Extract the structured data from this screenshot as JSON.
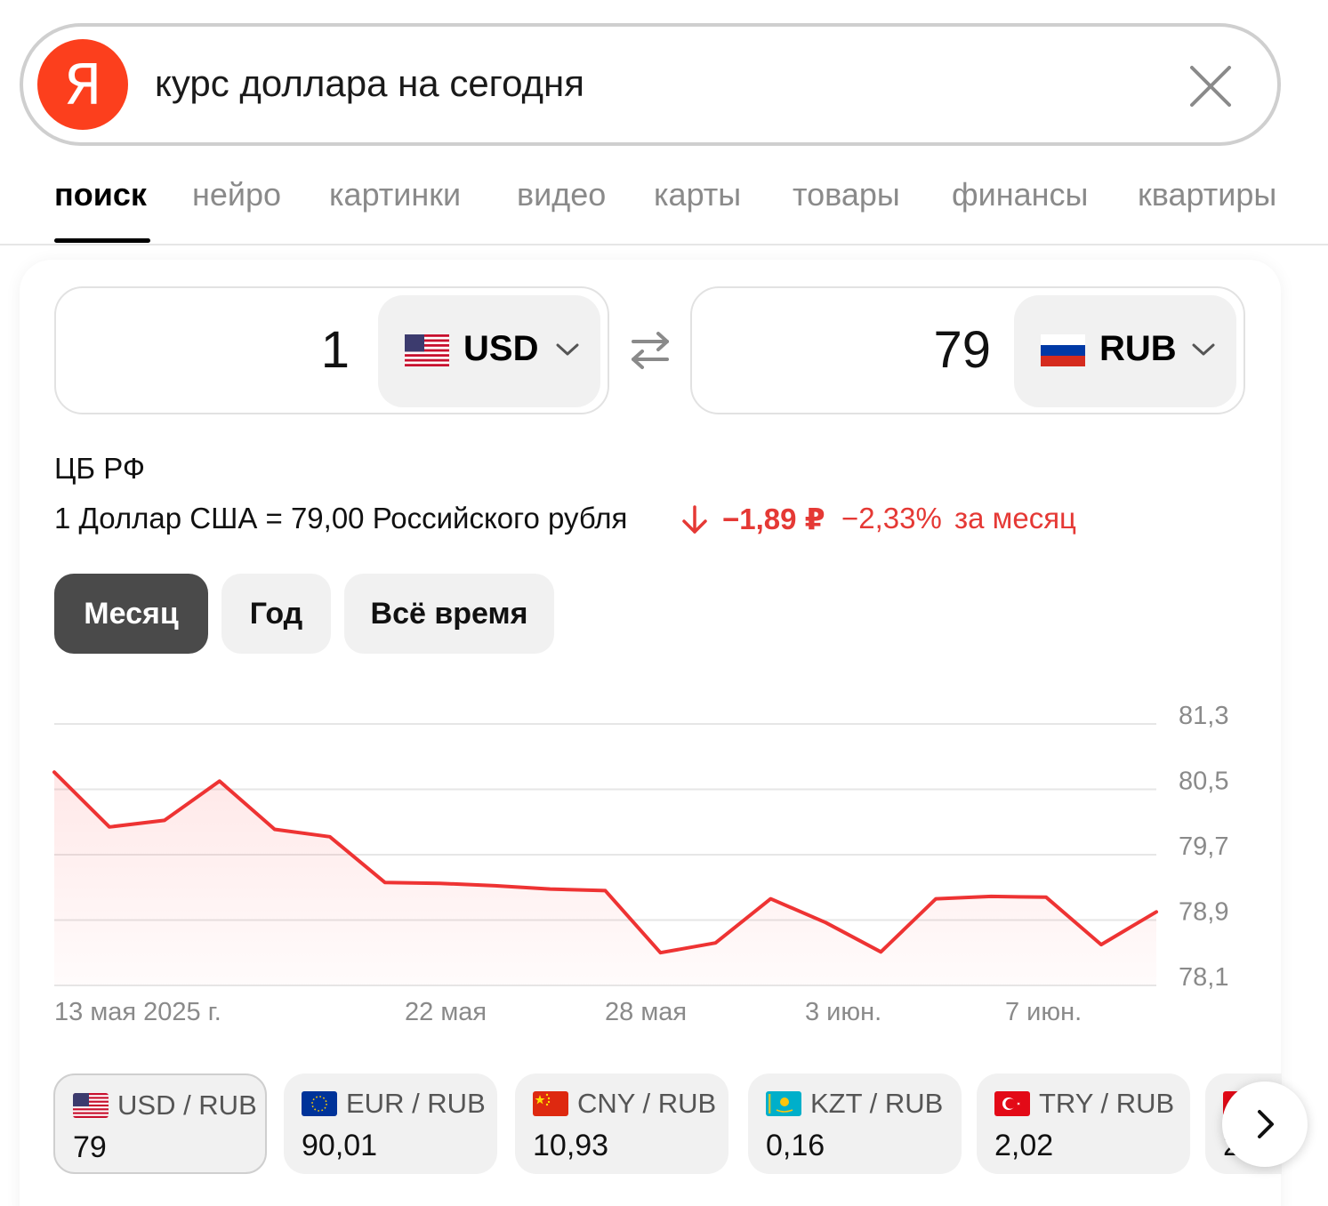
{
  "search": {
    "logo_letter": "Я",
    "query": "курс доллара на сегодня"
  },
  "tabs": [
    {
      "label": "поиск",
      "active": true
    },
    {
      "label": "нейро"
    },
    {
      "label": "картинки"
    },
    {
      "label": "видео"
    },
    {
      "label": "карты"
    },
    {
      "label": "товары"
    },
    {
      "label": "финансы"
    },
    {
      "label": "квартиры"
    }
  ],
  "converter": {
    "from": {
      "amount": "1",
      "currency": "USD"
    },
    "to": {
      "amount": "79",
      "currency": "RUB"
    }
  },
  "rate": {
    "source": "ЦБ РФ",
    "line": "1 Доллар США = 79,00 Российского рубля",
    "change_abs": "−1,89 ₽",
    "change_pct": "−2,33%",
    "change_period": "за месяц"
  },
  "periods": [
    {
      "label": "Месяц",
      "active": true
    },
    {
      "label": "Год"
    },
    {
      "label": "Всё время"
    }
  ],
  "chart_data": {
    "type": "area",
    "color": "#ee3333",
    "yticks": [
      "81,3",
      "80,5",
      "79,7",
      "78,9",
      "78,1"
    ],
    "ytick_values": [
      81.3,
      80.5,
      79.7,
      78.9,
      78.1
    ],
    "ylim": [
      78.1,
      81.3
    ],
    "xtick_labels": [
      "13 мая 2025 г.",
      "22 мая",
      "28 мая",
      "3 июн.",
      "7 июн."
    ],
    "x": [
      "13 мая",
      "15 мая",
      "16 мая",
      "17 мая",
      "20 мая",
      "21 мая",
      "22 мая",
      "23 мая",
      "24 мая",
      "27 мая",
      "28 мая",
      "29 мая",
      "30 мая",
      "31 мая",
      "3 июн.",
      "4 июн.",
      "5 июн.",
      "6 июн.",
      "7 июн.",
      "10 июн.",
      "11 июн."
    ],
    "values": [
      80.71,
      80.04,
      80.12,
      80.6,
      80.01,
      79.92,
      79.36,
      79.35,
      79.32,
      79.28,
      79.26,
      78.5,
      78.62,
      79.16,
      78.87,
      78.51,
      79.16,
      79.19,
      79.18,
      78.6,
      79.0
    ]
  },
  "pairs": [
    {
      "name": "USD / RUB",
      "value": "79",
      "selected": true
    },
    {
      "name": "EUR / RUB",
      "value": "90,01"
    },
    {
      "name": "CNY / RUB",
      "value": "10,93"
    },
    {
      "name": "KZT / RUB",
      "value": "0,16"
    },
    {
      "name": "TRY / RUB",
      "value": "2,02"
    }
  ],
  "pairs_partial": {
    "value": "2"
  }
}
